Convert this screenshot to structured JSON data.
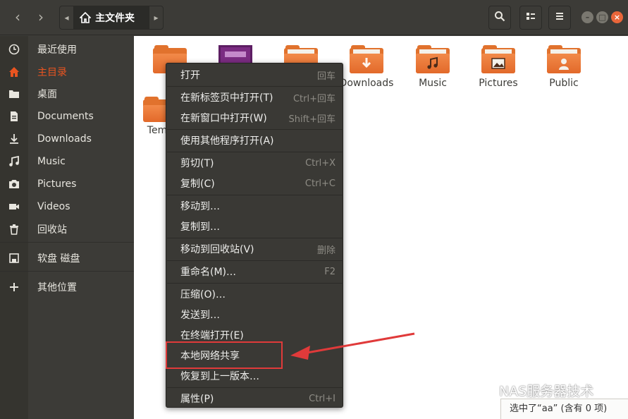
{
  "header": {
    "back_glyph": "‹",
    "forward_glyph": "›",
    "path_left_glyph": "◂",
    "path_right_glyph": "▸",
    "current_folder": "主文件夹",
    "window_controls": [
      "–",
      "□",
      "×"
    ]
  },
  "sidebar": {
    "items": [
      {
        "label": "最近使用",
        "icon": "clock-icon"
      },
      {
        "label": "主目录",
        "icon": "home-icon",
        "active": true
      },
      {
        "label": "桌面",
        "icon": "folder-icon"
      },
      {
        "label": "Documents",
        "icon": "document-icon"
      },
      {
        "label": "Downloads",
        "icon": "download-icon"
      },
      {
        "label": "Music",
        "icon": "music-icon"
      },
      {
        "label": "Pictures",
        "icon": "camera-icon"
      },
      {
        "label": "Videos",
        "icon": "video-icon"
      },
      {
        "label": "回收站",
        "icon": "trash-icon"
      },
      {
        "label": "软盘 磁盘",
        "icon": "floppy-icon"
      },
      {
        "label": "其他位置",
        "icon": "plus-icon"
      }
    ]
  },
  "files": {
    "downloads": "Downloads",
    "music": "Music",
    "pictures": "Pictures",
    "public": "Public",
    "templates_partial": "Tem"
  },
  "context_menu": {
    "items": [
      {
        "label": "打开",
        "accel": "回车"
      },
      {
        "label": "在新标签页中打开(T)",
        "accel": "Ctrl+回车"
      },
      {
        "label": "在新窗口中打开(W)",
        "accel": "Shift+回车"
      },
      {
        "label": "使用其他程序打开(A)",
        "accel": ""
      },
      {
        "label": "剪切(T)",
        "accel": "Ctrl+X"
      },
      {
        "label": "复制(C)",
        "accel": "Ctrl+C"
      },
      {
        "label": "移动到…",
        "accel": ""
      },
      {
        "label": "复制到…",
        "accel": ""
      },
      {
        "label": "移动到回收站(V)",
        "accel": "删除"
      },
      {
        "label": "重命名(M)…",
        "accel": "F2"
      },
      {
        "label": "压缩(O)…",
        "accel": ""
      },
      {
        "label": "发送到…",
        "accel": ""
      },
      {
        "label": "在终端打开(E)",
        "accel": ""
      },
      {
        "label": "本地网络共享",
        "accel": "",
        "highlighted": true
      },
      {
        "label": "恢复到上一版本…",
        "accel": ""
      },
      {
        "label": "属性(P)",
        "accel": "Ctrl+I"
      }
    ]
  },
  "status": {
    "text": "选中了“aa” (含有 0 项)"
  },
  "watermark": {
    "text": "NAS服务器技术"
  },
  "colors": {
    "accent": "#e95420",
    "folder": "#e1722d",
    "annotation": "#e03a3a"
  }
}
